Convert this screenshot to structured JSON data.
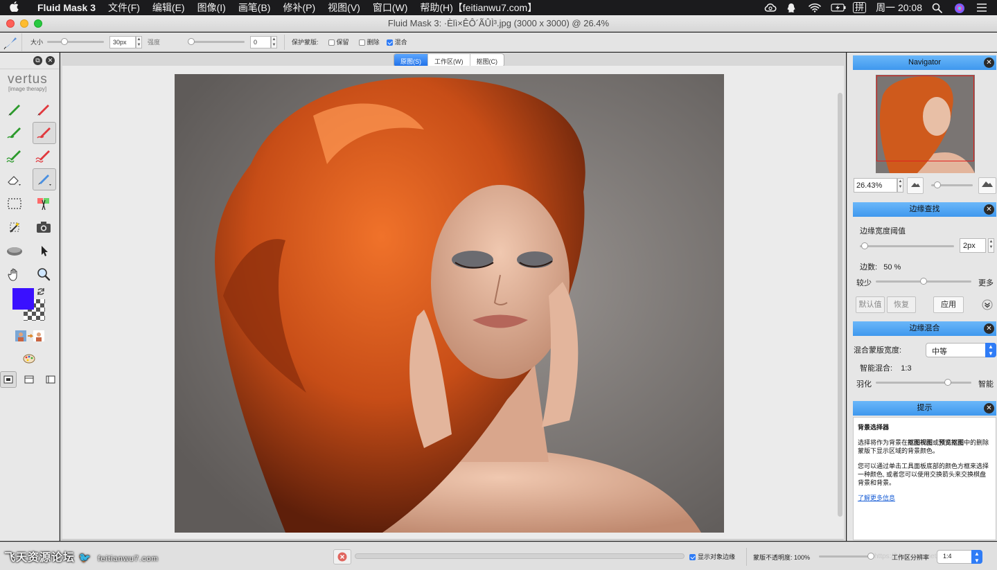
{
  "menubar": {
    "apple": "",
    "app_name": "Fluid Mask 3",
    "items": [
      "文件(F)",
      "编辑(E)",
      "图像(I)",
      "画笔(B)",
      "修补(P)",
      "视图(V)",
      "窗口(W)",
      "帮助(H)【feitianwu7.com】"
    ],
    "clock": "周一 20:08",
    "ime": "拼"
  },
  "window": {
    "title": "Fluid Mask 3: ·Èlì×ÊÔ´ÃÛÌ³.jpg (3000 x 3000) @ 26.4%"
  },
  "options": {
    "size_label": "大小",
    "size_value": "30px",
    "size_fraction": 0.3,
    "strength_label": "强度",
    "strength_value": "0",
    "strength_fraction": 0.0,
    "protect_label": "保护蒙版:",
    "keep_label": "保留",
    "keep_checked": false,
    "delete_label": "删除",
    "delete_checked": false,
    "blend_label": "混合",
    "blend_checked": true
  },
  "left_panel": {
    "logo_main": "vertus",
    "logo_sub": "[image therapy]",
    "colors": {
      "foreground": "#3a10ff"
    }
  },
  "canvas": {
    "tabs": [
      {
        "label": "原图(S)",
        "active": true
      },
      {
        "label": "工作区(W)",
        "active": false
      },
      {
        "label": "抠图(C)",
        "active": false
      }
    ]
  },
  "navigator": {
    "title": "Navigator",
    "zoom_value": "26.43%",
    "zoom_fraction": 0.15
  },
  "edge_find": {
    "title": "边缘查找",
    "threshold_label": "边缘宽度阈值",
    "threshold_value": "2px",
    "threshold_fraction": 0.05,
    "edges_label": "边数:",
    "edges_value": "50 %",
    "edges_fraction": 0.5,
    "less_label": "较少",
    "more_label": "更多",
    "default_button": "默认值",
    "restore_button": "恢复",
    "apply_button": "应用"
  },
  "edge_blend": {
    "title": "边缘混合",
    "width_label": "混合蒙版宽度:",
    "width_value": "中等",
    "smart_label": "智能混合:",
    "smart_value": "1:3",
    "feather_label": "羽化",
    "smart_right_label": "智能",
    "feather_fraction": 0.75
  },
  "hint": {
    "title": "提示",
    "heading": "背景选择器",
    "p1_a": "选择将作为背景在",
    "p1_b": "抠图视图",
    "p1_c": "或",
    "p1_d": "预览抠图",
    "p1_e": "中的删除蒙版下显示区域的背景颜色。",
    "p2": "您可以通过单击工具面板底部的颜色方框来选择一种颜色, 或者您可以使用交换箭头来交换棋盘背景和背景。",
    "link": "了解更多信息"
  },
  "status": {
    "show_edges_label": "显示对象边缘",
    "show_edges_checked": true,
    "mask_opacity_label": "蒙版不透明度: 100%",
    "mask_opacity_fraction": 1.0,
    "resolution_label": "工作区分辨率",
    "resolution_value": "1:4",
    "watermark_main": "飞天资源论坛",
    "watermark_site": "feitianwu7.com",
    "watermark_right": "https://blog.csdn.net/w"
  }
}
